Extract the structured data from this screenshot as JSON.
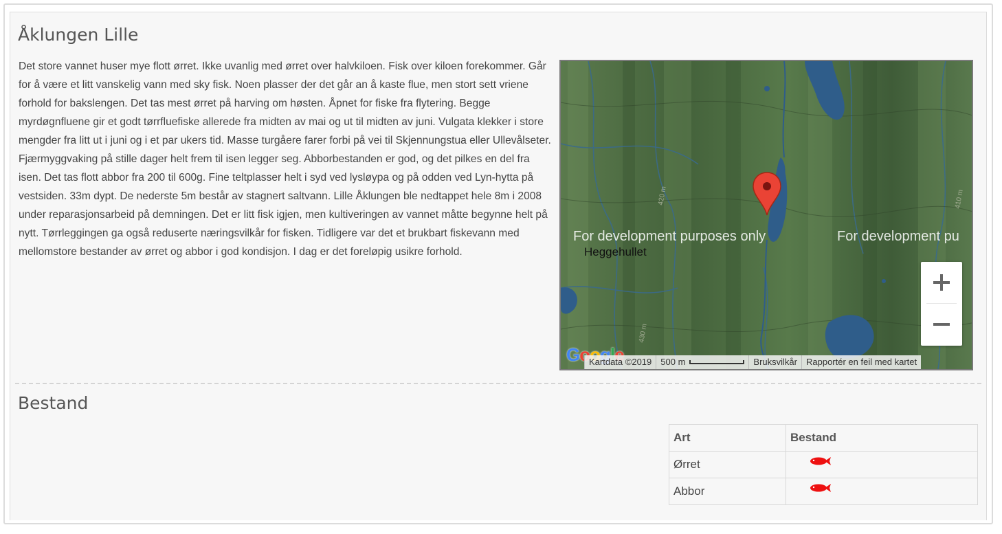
{
  "lake": {
    "title": "Åklungen Lille",
    "description": "Det store vannet huser mye flott ørret. Ikke uvanlig med ørret over halvkiloen. Fisk over kiloen forekommer. Går for å være et litt vanskelig vann med sky fisk. Noen plasser der det går an å kaste flue, men stort sett vriene forhold for bakslengen. Det tas mest ørret på harving om høsten. Åpnet for fiske fra flytering. Begge myrdøgnfluene gir et godt tørrfluefiske allerede fra midten av mai og ut til midten av juni. Vulgata klekker i store mengder fra litt ut i juni og i et par ukers tid. Masse turgåere farer forbi på vei til Skjennungstua eller Ullevålseter. Fjærmyggvaking på stille dager helt frem til isen legger seg. Abborbestanden er god, og det pilkes en del fra isen. Det tas flott abbor fra 200 til 600g. Fine teltplasser helt i syd ved lysløypa og på odden ved Lyn-hytta på vestsiden. 33m dypt. De nederste 5m består av stagnert saltvann. Lille Åklungen ble nedtappet hele 8m i 2008 under reparasjonsarbeid på demningen. Det er litt fisk igjen, men kultiveringen av vannet måtte begynne helt på nytt. Tørrleggingen ga også reduserte næringsvilkår for fisken. Tidligere var det et brukbart fiskevann med mellomstore bestander av ørret og abbor i god kondisjon. I dag er det foreløpig usikre forhold."
  },
  "map": {
    "watermark_left": "For development purposes only",
    "watermark_right": "For development pu",
    "place_label": "Heggehullet",
    "contour_labels": [
      "420 m",
      "430 m",
      "410 m"
    ],
    "logo": "Google",
    "attribution": {
      "kartdata": "Kartdata ©2019",
      "scale": "500 m",
      "terms": "Bruksvilkår",
      "report": "Rapportér en feil med kartet"
    },
    "marker_color": "#ea4335",
    "water_color": "#2f5d8a",
    "land_color": "#4e6c43"
  },
  "bestand": {
    "heading": "Bestand",
    "columns": [
      "Art",
      "Bestand"
    ],
    "rows": [
      {
        "art": "Ørret",
        "level": 1,
        "icon": "fish-icon"
      },
      {
        "art": "Abbor",
        "level": 1,
        "icon": "fish-icon"
      }
    ],
    "fish_color": "#ee1111"
  }
}
